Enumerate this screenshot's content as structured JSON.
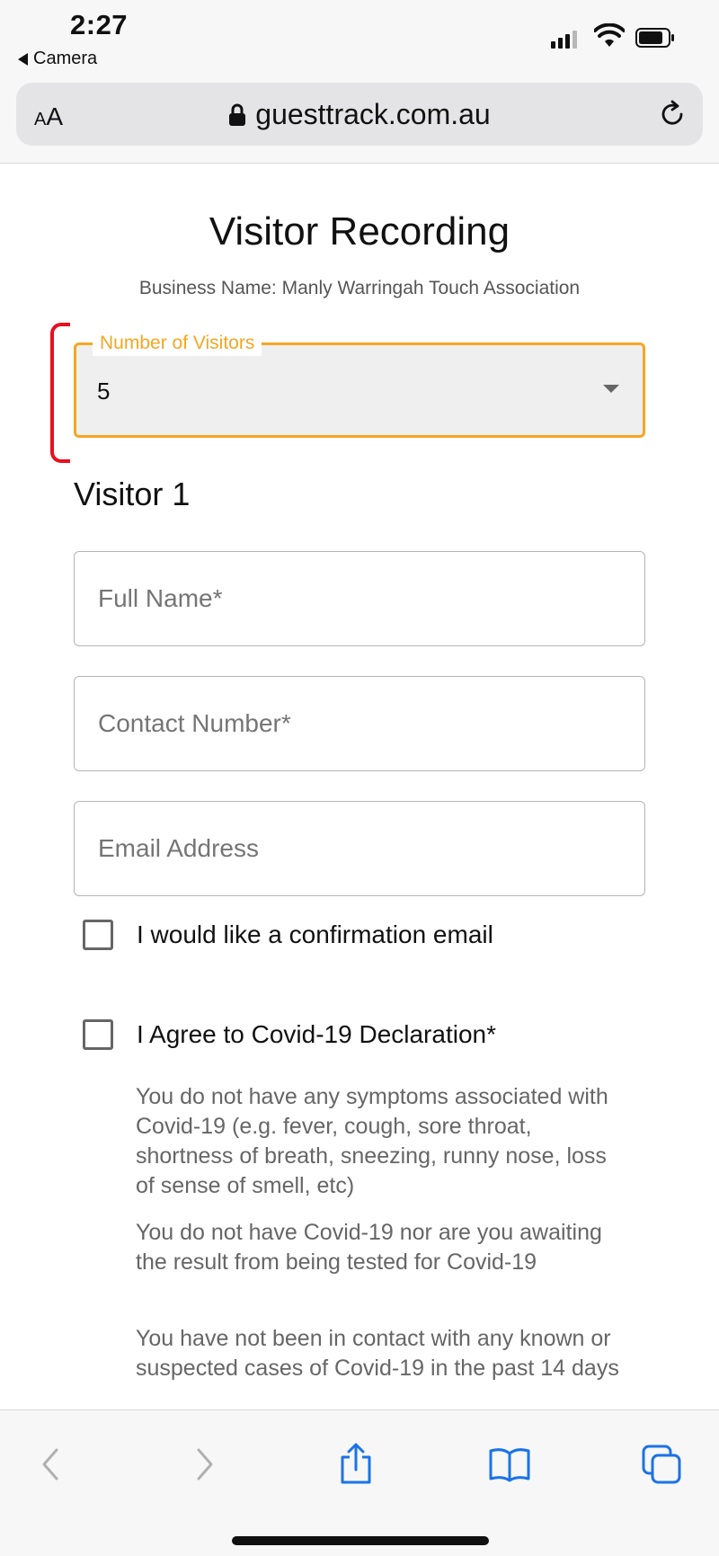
{
  "status": {
    "time": "2:27",
    "back_app": "Camera"
  },
  "browser": {
    "text_size_label_small": "A",
    "text_size_label_large": "A",
    "url": "guesttrack.com.au"
  },
  "page": {
    "title": "Visitor Recording",
    "business_name": "Business Name: Manly Warringah Touch Association",
    "visitors_select": {
      "label": "Number of Visitors",
      "value": "5"
    },
    "visitor_heading": "Visitor 1",
    "fields": {
      "full_name_placeholder": "Full Name*",
      "contact_number_placeholder": "Contact Number*",
      "email_placeholder": "Email Address"
    },
    "confirmation_email_label": "I would like a confirmation email",
    "covid_declaration_label": "I Agree to Covid-19 Declaration*",
    "declarations": [
      "You do not have any symptoms associated with Covid-19 (e.g. fever, cough, sore throat, shortness of breath, sneezing, runny nose, loss of sense of smell, etc)",
      "You do not have Covid-19 nor are you awaiting the result from being tested for Covid-19",
      "You have not been in contact with any known or suspected cases of Covid-19 in the past 14 days"
    ]
  },
  "colors": {
    "accent_orange": "#f5a623",
    "highlight_red": "#e8101f",
    "ios_blue": "#1a73e8"
  },
  "icons": {
    "back": "chevron-left-icon",
    "forward": "chevron-right-icon",
    "share": "share-icon",
    "bookmarks": "book-icon",
    "tabs": "tabs-icon",
    "lock": "lock-icon",
    "reload": "reload-icon"
  }
}
